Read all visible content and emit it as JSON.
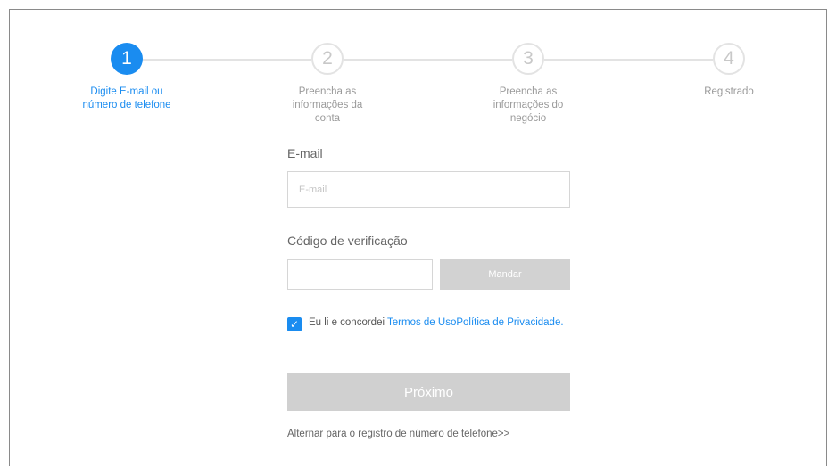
{
  "stepper": {
    "steps": [
      {
        "number": "1",
        "label_line1": "Digite E-mail ou",
        "label_line2": "número de telefone",
        "label_line3": ""
      },
      {
        "number": "2",
        "label_line1": "Preencha as",
        "label_line2": "informações da",
        "label_line3": "conta"
      },
      {
        "number": "3",
        "label_line1": "Preencha as",
        "label_line2": "informações do",
        "label_line3": "negócio"
      },
      {
        "number": "4",
        "label_line1": "Registrado",
        "label_line2": "",
        "label_line3": ""
      }
    ],
    "active_step": 1
  },
  "form": {
    "email_label": "E-mail",
    "email_placeholder": "E-mail",
    "email_value": "",
    "code_label": "Código de verificação",
    "code_value": "",
    "send_button": "Mandar",
    "agree_checked": true,
    "agree_text": "Eu li e concordei ",
    "terms_link": "Termos de Uso",
    "privacy_link": "Política de Privacidade",
    "agree_end": ".",
    "next_button": "Próximo",
    "switch_link": "Alternar para o registro de número de telefone>>"
  },
  "colors": {
    "accent": "#1a8cf0",
    "disabled_button": "#d0d0d0",
    "step_inactive": "#e3e3e3"
  }
}
